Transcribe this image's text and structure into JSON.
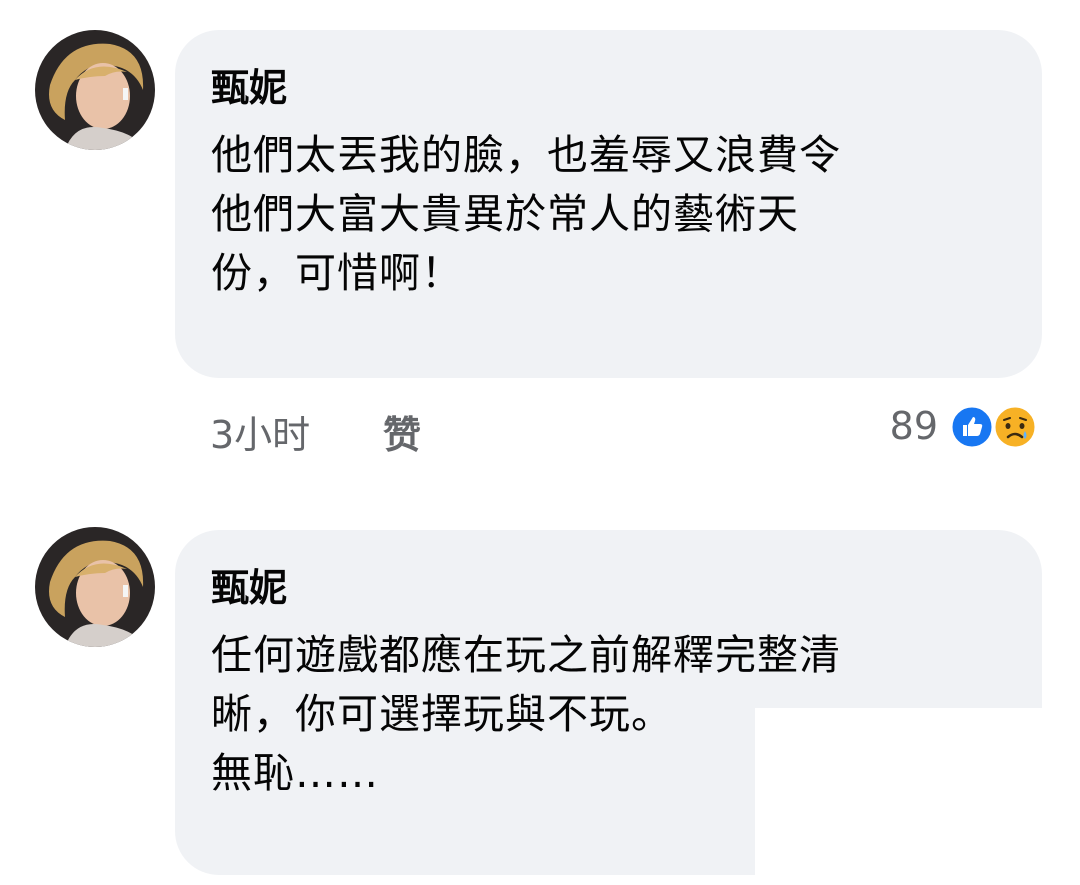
{
  "comments": [
    {
      "author": "甄妮",
      "lines": [
        "他們太丟我的臉，也羞辱又浪費令",
        "他們大富大貴異於常人的藝術天",
        "份，可惜啊！"
      ],
      "time": "3小时",
      "like_label": "赞",
      "reaction_count": "89",
      "reactions": [
        "like-icon",
        "sad-face-icon"
      ]
    },
    {
      "author": "甄妮",
      "lines": [
        "任何遊戲都應在玩之前解釋完整清",
        "晰，你可選擇玩與不玩。",
        "無恥……"
      ]
    }
  ],
  "colors": {
    "bubble": "#f0f2f5",
    "meta_text": "#65676b",
    "like_blue": "#1877f2",
    "sad_yellow": "#f7b125"
  }
}
